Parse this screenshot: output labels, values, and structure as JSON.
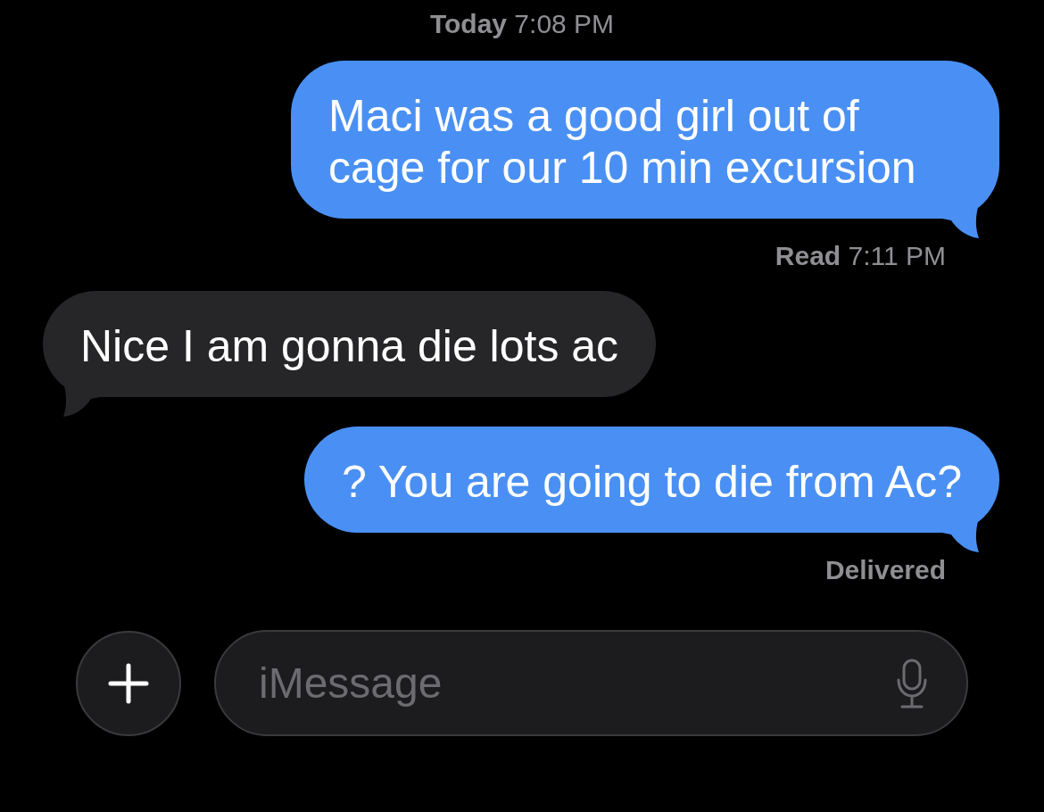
{
  "header": {
    "day": "Today",
    "time": "7:08 PM"
  },
  "messages": [
    {
      "kind": "sent",
      "text": "Maci was a good girl out of cage for our 10 min excursion",
      "receipt": {
        "status": "Read",
        "time": "7:11 PM"
      }
    },
    {
      "kind": "received",
      "text": "Nice I am gonna die lots ac"
    },
    {
      "kind": "sent",
      "text": "? You are going to die from Ac?",
      "receipt": {
        "status": "Delivered"
      }
    }
  ],
  "composer": {
    "placeholder": "iMessage"
  }
}
